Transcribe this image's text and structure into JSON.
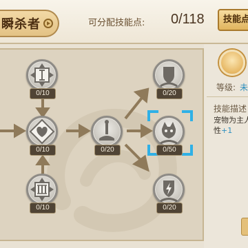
{
  "header": {
    "title": "瞬杀者",
    "points_label": "可分配技能点:",
    "points_value": "0/118",
    "skill_points_button": "技能点"
  },
  "tree": {
    "nodes": [
      {
        "id": "node-top-left",
        "icon": "arrows-vertical-icon",
        "count": "0/10"
      },
      {
        "id": "node-mid-left",
        "icon": "heart-icon",
        "count": "0/10"
      },
      {
        "id": "node-bottom-left",
        "icon": "roman-three-icon",
        "count": "0/10"
      },
      {
        "id": "node-mid-center",
        "icon": "sword-icon",
        "count": "0/20"
      },
      {
        "id": "node-top-right",
        "icon": "shield-icon",
        "count": "0/20"
      },
      {
        "id": "node-mid-right",
        "icon": "pet-head-icon",
        "count": "0/50",
        "selected": true
      },
      {
        "id": "node-bottom-right",
        "icon": "lightning-shield-icon",
        "count": "0/20"
      }
    ]
  },
  "info": {
    "level_label": "等级:",
    "level_value": "未",
    "desc_label": "技能描述",
    "desc_line1_a": "宠物为主人",
    "desc_line2_a": "性",
    "desc_line2_b": "+1"
  },
  "colors": {
    "accent_blue": "#2d8fbf",
    "title_gold": "#e3c285",
    "node_gray": "#b3afa6",
    "panel_bg": "#ddd3c0"
  }
}
